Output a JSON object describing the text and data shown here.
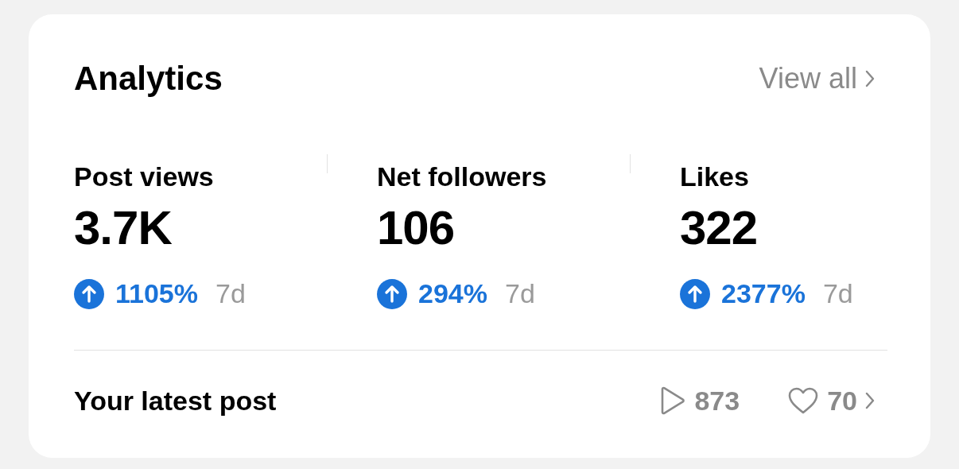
{
  "card": {
    "title": "Analytics",
    "view_all": "View all"
  },
  "stats": [
    {
      "label": "Post views",
      "value": "3.7K",
      "change": "1105%",
      "period": "7d"
    },
    {
      "label": "Net followers",
      "value": "106",
      "change": "294%",
      "period": "7d"
    },
    {
      "label": "Likes",
      "value": "322",
      "change": "2377%",
      "period": "7d"
    }
  ],
  "latest_post": {
    "label": "Your latest post",
    "plays": "873",
    "likes": "70"
  }
}
